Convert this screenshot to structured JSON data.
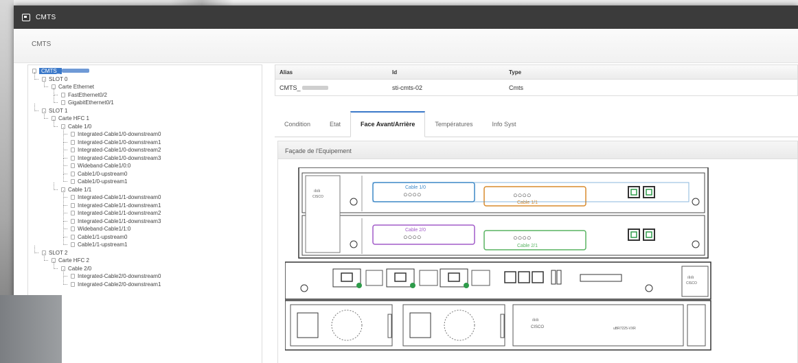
{
  "window": {
    "title": "CMTS"
  },
  "subheader": {
    "title": "CMTS"
  },
  "tree": [
    {
      "label": "CMTS_",
      "level": 0,
      "selected": true
    },
    {
      "label": "SLOT 0",
      "level": 1
    },
    {
      "label": "Carte Ethernet",
      "level": 2
    },
    {
      "label": "FastEthernet0/2",
      "level": 3
    },
    {
      "label": "GigabitEthernet0/1",
      "level": 3
    },
    {
      "label": "SLOT 1",
      "level": 1
    },
    {
      "label": "Carte HFC 1",
      "level": 2
    },
    {
      "label": "Cable 1/0",
      "level": 3
    },
    {
      "label": "Integrated-Cable1/0-downstream0",
      "level": 4
    },
    {
      "label": "Integrated-Cable1/0-downstream1",
      "level": 4
    },
    {
      "label": "Integrated-Cable1/0-downstream2",
      "level": 4
    },
    {
      "label": "Integrated-Cable1/0-downstream3",
      "level": 4
    },
    {
      "label": "Wideband-Cable1/0:0",
      "level": 4
    },
    {
      "label": "Cable1/0-upstream0",
      "level": 4
    },
    {
      "label": "Cable1/0-upstream1",
      "level": 4
    },
    {
      "label": "Cable 1/1",
      "level": 3
    },
    {
      "label": "Integrated-Cable1/1-downstream0",
      "level": 4
    },
    {
      "label": "Integrated-Cable1/1-downstream1",
      "level": 4
    },
    {
      "label": "Integrated-Cable1/1-downstream2",
      "level": 4
    },
    {
      "label": "Integrated-Cable1/1-downstream3",
      "level": 4
    },
    {
      "label": "Wideband-Cable1/1:0",
      "level": 4
    },
    {
      "label": "Cable1/1-upstream0",
      "level": 4
    },
    {
      "label": "Cable1/1-upstream1",
      "level": 4
    },
    {
      "label": "SLOT 2",
      "level": 1
    },
    {
      "label": "Carte HFC 2",
      "level": 2
    },
    {
      "label": "Cable 2/0",
      "level": 3
    },
    {
      "label": "Integrated-Cable2/0-downstream0",
      "level": 4
    },
    {
      "label": "Integrated-Cable2/0-downstream1",
      "level": 4
    }
  ],
  "grid": {
    "headers": [
      "Alias",
      "Id",
      "Type"
    ],
    "row": {
      "alias": "CMTS_",
      "id": "sti-cmts-02",
      "type": "Cmts"
    }
  },
  "tabs": [
    "Condition",
    "Etat",
    "Face Avant/Arrière",
    "Températures",
    "Info Syst"
  ],
  "active_tab": 2,
  "panel": {
    "title": "Façade de l'Equipement"
  },
  "device": {
    "brand": "CISCO",
    "model": "uBR7225-VXR",
    "card_labels": [
      "Cable 1/0",
      "Cable 1/1",
      "Cable 2/0",
      "Cable 2/1"
    ],
    "colors": {
      "cable10": "#3c87c6",
      "cable11": "#d98a2b",
      "cable20": "#a15ac8",
      "cable21": "#58b361"
    }
  }
}
